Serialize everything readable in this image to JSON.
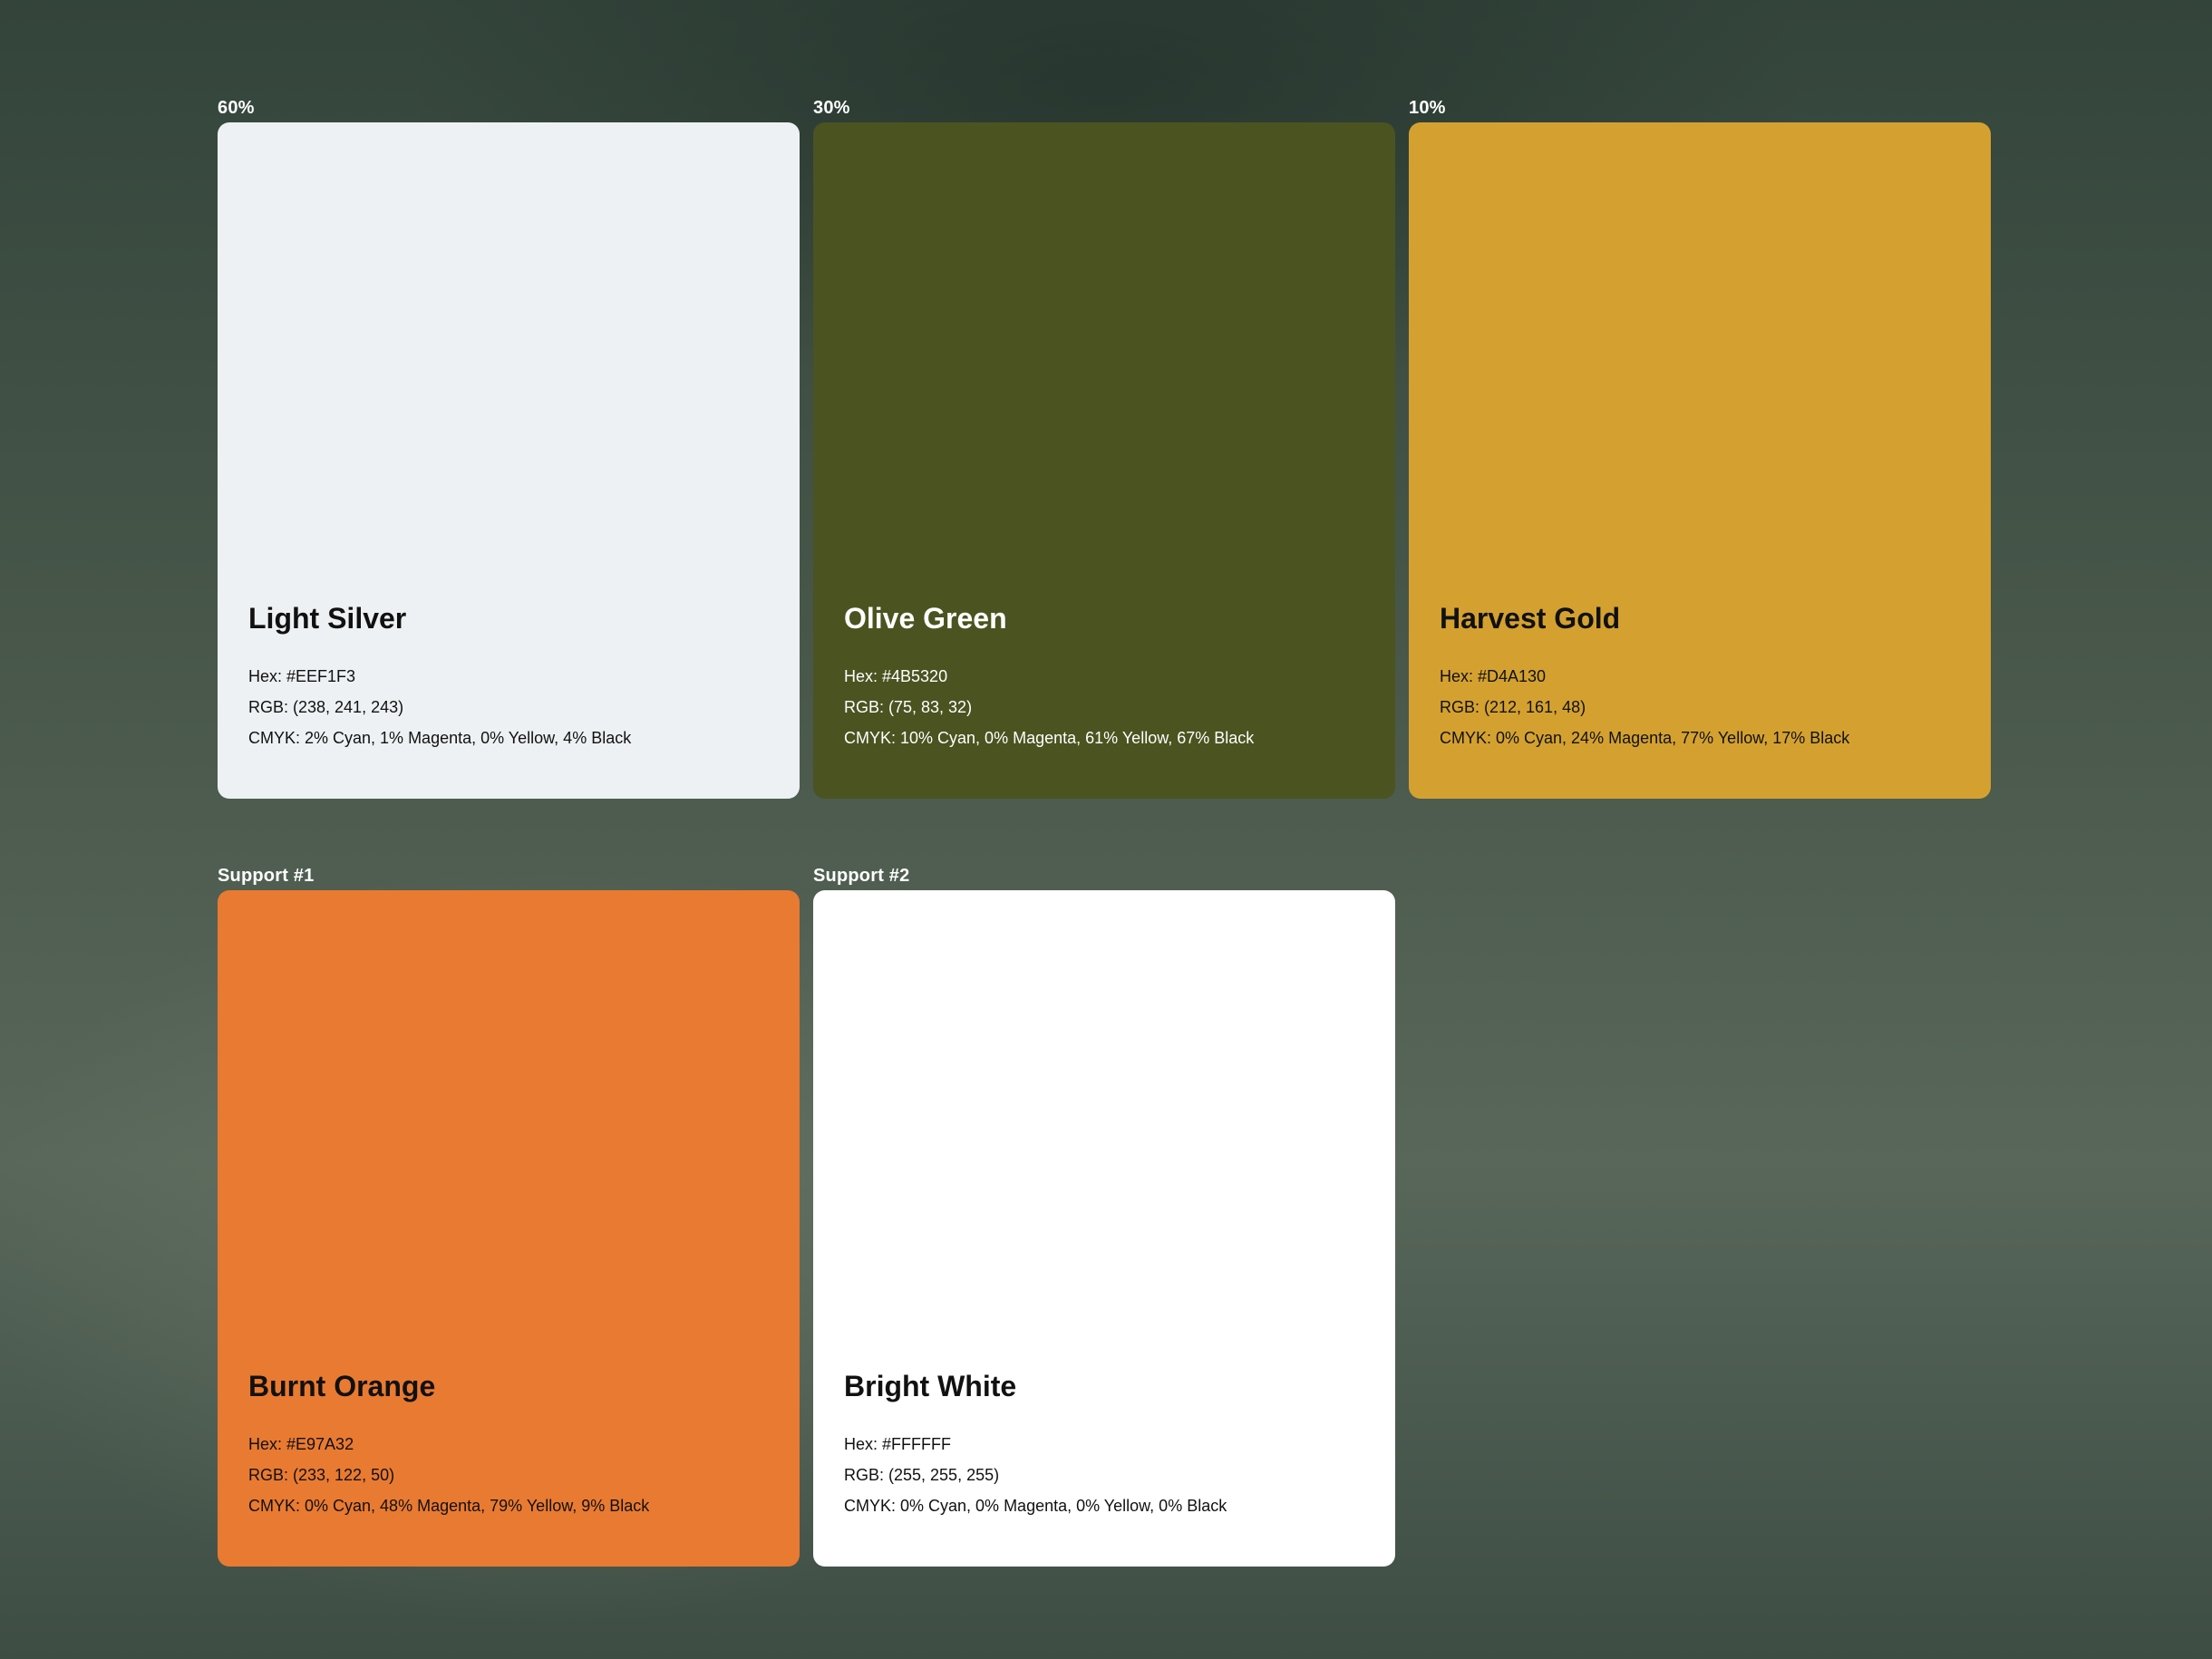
{
  "swatches": [
    {
      "label": "60%",
      "name": "Light Silver",
      "hex": "Hex: #EEF1F3",
      "rgb": "RGB: (238, 241, 243)",
      "cmyk": "CMYK: 2% Cyan, 1% Magenta, 0% Yellow, 4% Black",
      "color": "#EEF1F3",
      "text_color": "#111111"
    },
    {
      "label": "30%",
      "name": "Olive Green",
      "hex": "Hex: #4B5320",
      "rgb": "RGB: (75, 83, 32)",
      "cmyk": "CMYK: 10% Cyan, 0% Magenta, 61% Yellow, 67% Black",
      "color": "#4B5320",
      "text_color": "#FFFFFF"
    },
    {
      "label": "10%",
      "name": "Harvest Gold",
      "hex": "Hex: #D4A130",
      "rgb": "RGB: (212, 161, 48)",
      "cmyk": "CMYK: 0% Cyan, 24% Magenta, 77% Yellow, 17% Black",
      "color": "#D4A130",
      "text_color": "#111111"
    },
    {
      "label": "Support #1",
      "name": "Burnt Orange",
      "hex": "Hex: #E97A32",
      "rgb": "RGB: (233, 122, 50)",
      "cmyk": "CMYK: 0% Cyan, 48% Magenta, 79% Yellow, 9% Black",
      "color": "#E97A32",
      "text_color": "#111111"
    },
    {
      "label": "Support #2",
      "name": "Bright White",
      "hex": "Hex: #FFFFFF",
      "rgb": "RGB: (255, 255, 255)",
      "cmyk": "CMYK: 0% Cyan, 0% Magenta, 0% Yellow, 0% Black",
      "color": "#FFFFFF",
      "text_color": "#111111"
    }
  ]
}
